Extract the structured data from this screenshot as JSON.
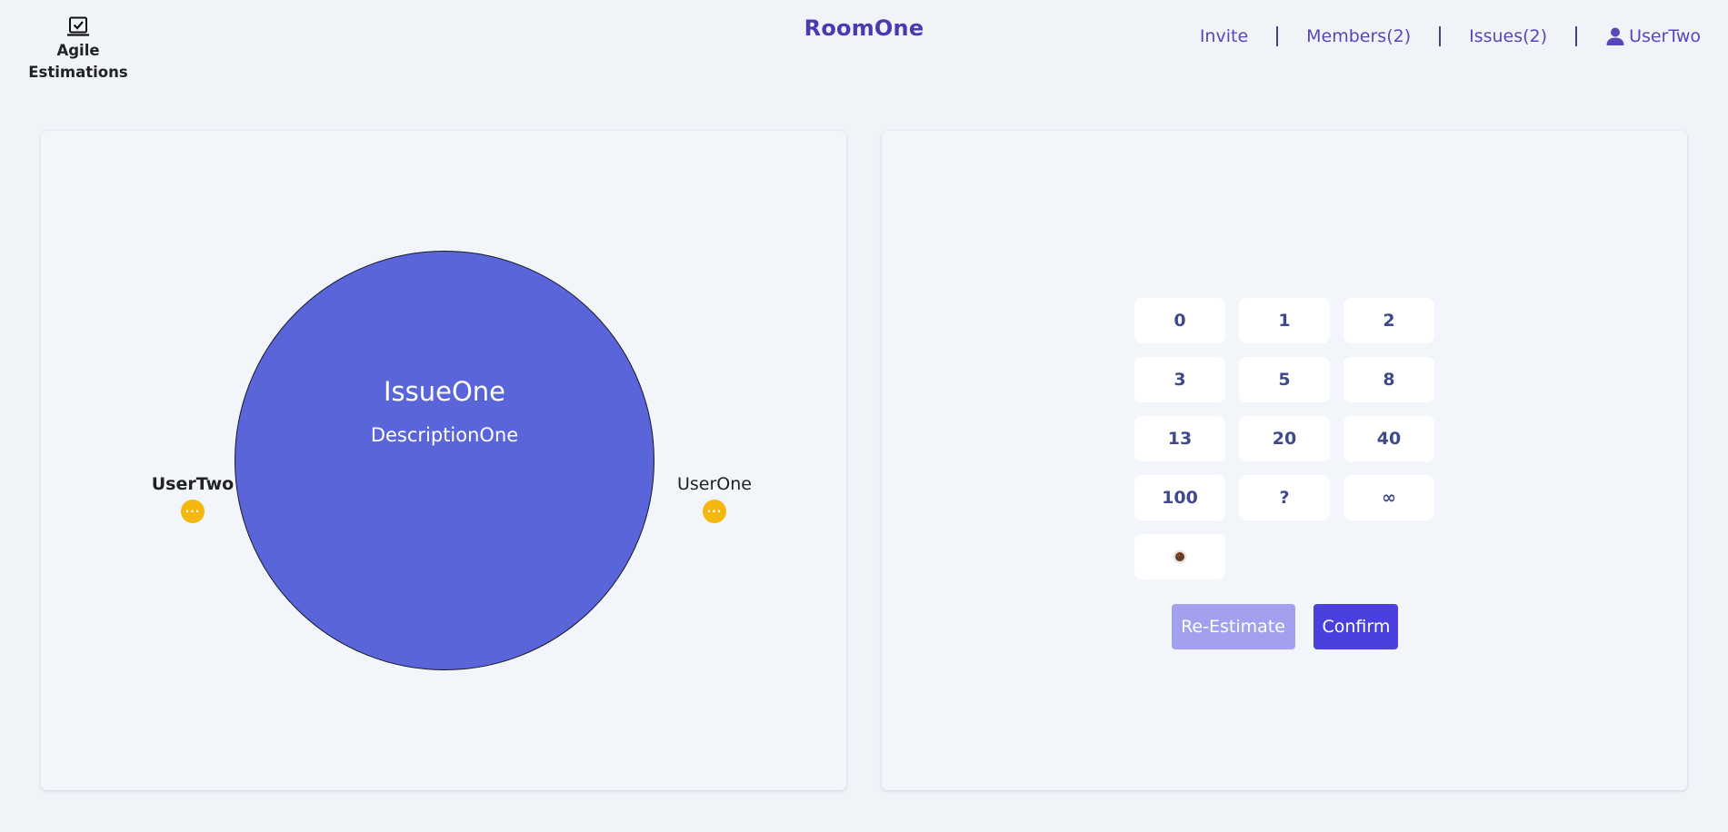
{
  "header": {
    "logo_line1": "Agile",
    "logo_line2": "Estimations",
    "room_name": "RoomOne",
    "nav": {
      "invite": "Invite",
      "members": "Members(2)",
      "issues": "Issues(2)",
      "user": "UserTwo"
    }
  },
  "table": {
    "issue_title": "IssueOne",
    "issue_description": "DescriptionOne",
    "players": [
      {
        "name": "UserTwo",
        "status": "···"
      },
      {
        "name": "UserOne",
        "status": "···"
      }
    ]
  },
  "cards": {
    "values": [
      "0",
      "1",
      "2",
      "3",
      "5",
      "8",
      "13",
      "20",
      "40",
      "100",
      "?",
      "∞"
    ],
    "coffee_icon": "coffee-cup-icon"
  },
  "actions": {
    "reestimate_label": "Re-Estimate",
    "confirm_label": "Confirm"
  },
  "colors": {
    "brand": "#4a3ab0",
    "circle": "#5965d8",
    "status_pending": "#f3b70f",
    "confirm": "#4a40dd",
    "reestimate": "#a3a1ef"
  }
}
